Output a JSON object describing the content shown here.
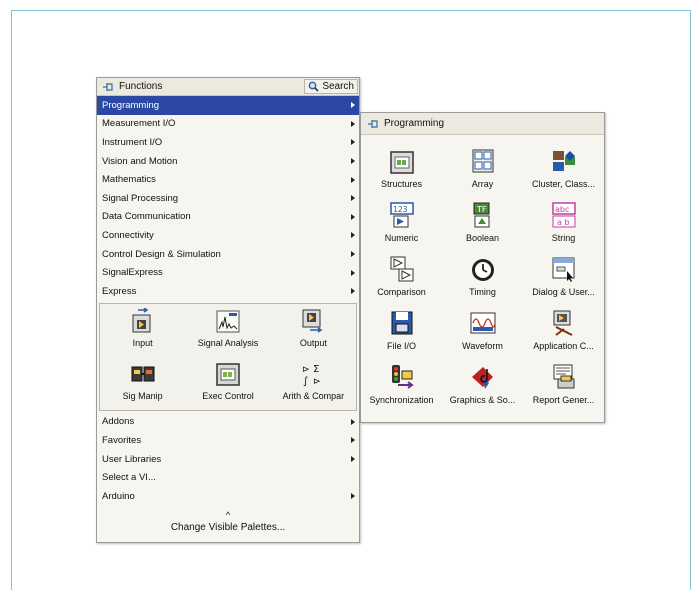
{
  "functions_palette": {
    "title": "Functions",
    "search_label": "Search",
    "items": [
      {
        "label": "Programming",
        "submenu": true,
        "selected": true
      },
      {
        "label": "Measurement I/O",
        "submenu": true
      },
      {
        "label": "Instrument I/O",
        "submenu": true
      },
      {
        "label": "Vision and Motion",
        "submenu": true
      },
      {
        "label": "Mathematics",
        "submenu": true
      },
      {
        "label": "Signal Processing",
        "submenu": true
      },
      {
        "label": "Data Communication",
        "submenu": true
      },
      {
        "label": "Connectivity",
        "submenu": true
      },
      {
        "label": "Control Design & Simulation",
        "submenu": true
      },
      {
        "label": "SignalExpress",
        "submenu": true
      },
      {
        "label": "Express",
        "submenu": true
      }
    ],
    "express_items": [
      {
        "label": "Input",
        "icon": "input-icon"
      },
      {
        "label": "Signal Analysis",
        "icon": "signal-analysis-icon"
      },
      {
        "label": "Output",
        "icon": "output-icon"
      },
      {
        "label": "Sig Manip",
        "icon": "sig-manip-icon"
      },
      {
        "label": "Exec Control",
        "icon": "exec-control-icon"
      },
      {
        "label": "Arith & Compar",
        "icon": "arith-compar-icon"
      }
    ],
    "bottom_items": [
      {
        "label": "Addons",
        "submenu": true
      },
      {
        "label": "Favorites",
        "submenu": true
      },
      {
        "label": "User Libraries",
        "submenu": true
      },
      {
        "label": "Select a VI...",
        "submenu": false
      },
      {
        "label": "Arduino",
        "submenu": true
      }
    ],
    "collapse_glyph": "^",
    "change_palettes_label": "Change Visible Palettes..."
  },
  "programming_palette": {
    "title": "Programming",
    "items": [
      {
        "label": "Structures",
        "icon": "structures-icon"
      },
      {
        "label": "Array",
        "icon": "array-icon"
      },
      {
        "label": "Cluster, Class...",
        "icon": "cluster-class-icon"
      },
      {
        "label": "Numeric",
        "icon": "numeric-icon"
      },
      {
        "label": "Boolean",
        "icon": "boolean-icon"
      },
      {
        "label": "String",
        "icon": "string-icon"
      },
      {
        "label": "Comparison",
        "icon": "comparison-icon"
      },
      {
        "label": "Timing",
        "icon": "timing-icon"
      },
      {
        "label": "Dialog & User...",
        "icon": "dialog-user-icon"
      },
      {
        "label": "File I/O",
        "icon": "file-io-icon"
      },
      {
        "label": "Waveform",
        "icon": "waveform-icon"
      },
      {
        "label": "Application C...",
        "icon": "application-control-icon"
      },
      {
        "label": "Synchronization",
        "icon": "synchronization-icon"
      },
      {
        "label": "Graphics & So...",
        "icon": "graphics-sound-icon"
      },
      {
        "label": "Report Gener...",
        "icon": "report-generation-icon"
      }
    ]
  },
  "colors": {
    "selection": "#2b49a4",
    "frame_border": "#7fc4cf",
    "palette_bg": "#f6f5ef"
  }
}
